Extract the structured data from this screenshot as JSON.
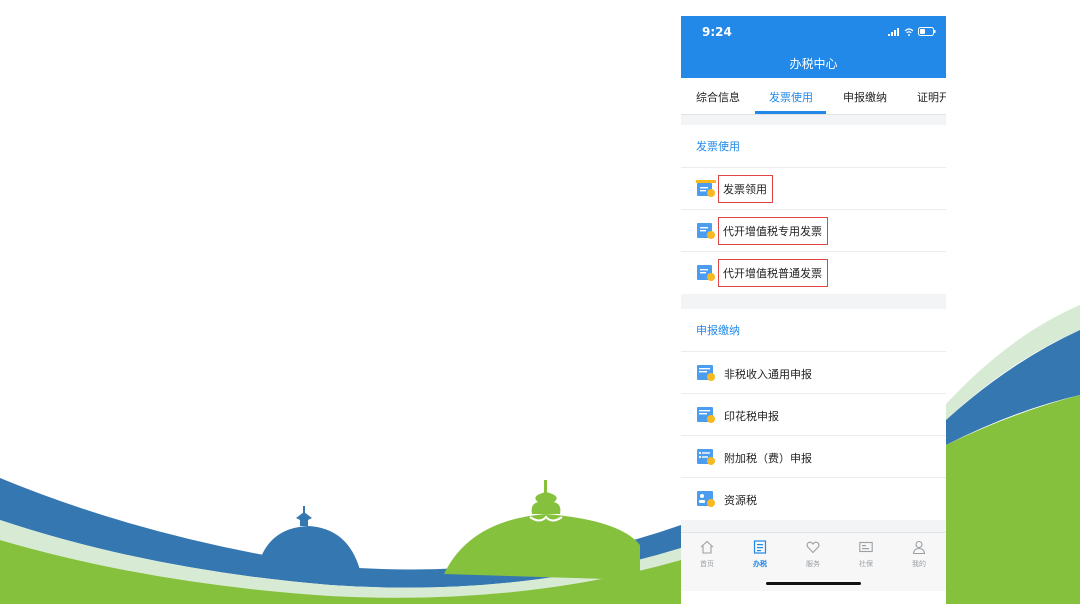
{
  "status_bar": {
    "time": "9:24"
  },
  "header": {
    "title": "办税中心"
  },
  "tabs": [
    {
      "label": "综合信息",
      "active": false
    },
    {
      "label": "发票使用",
      "active": true
    },
    {
      "label": "申报缴纳",
      "active": false
    },
    {
      "label": "证明开",
      "active": false
    }
  ],
  "sections": [
    {
      "title": "发票使用",
      "items": [
        {
          "label": "发票领用",
          "highlighted": true,
          "icon": "invoice-pickup-icon"
        },
        {
          "label": "代开增值税专用发票",
          "highlighted": true,
          "icon": "vat-special-invoice-icon"
        },
        {
          "label": "代开增值税普通发票",
          "highlighted": true,
          "icon": "vat-general-invoice-icon"
        }
      ]
    },
    {
      "title": "申报缴纳",
      "items": [
        {
          "label": "非税收入通用申报",
          "icon": "non-tax-income-icon"
        },
        {
          "label": "印花税申报",
          "icon": "stamp-tax-icon"
        },
        {
          "label": "附加税（费）申报",
          "icon": "surtax-icon"
        },
        {
          "label": "资源税",
          "icon": "resource-tax-icon"
        }
      ]
    }
  ],
  "bottom_nav": [
    {
      "label": "首页",
      "icon": "home-icon",
      "active": false
    },
    {
      "label": "办税",
      "icon": "tax-document-icon",
      "active": true
    },
    {
      "label": "服务",
      "icon": "heart-icon",
      "active": false
    },
    {
      "label": "社保",
      "icon": "social-security-card-icon",
      "active": false
    },
    {
      "label": "我的",
      "icon": "person-icon",
      "active": false
    }
  ],
  "colors": {
    "primary": "#2289e8",
    "highlight_box": "#e04545",
    "wave_blue": "#3577b1",
    "wave_green": "#86c13e",
    "icon_yellow": "#f7b820"
  }
}
